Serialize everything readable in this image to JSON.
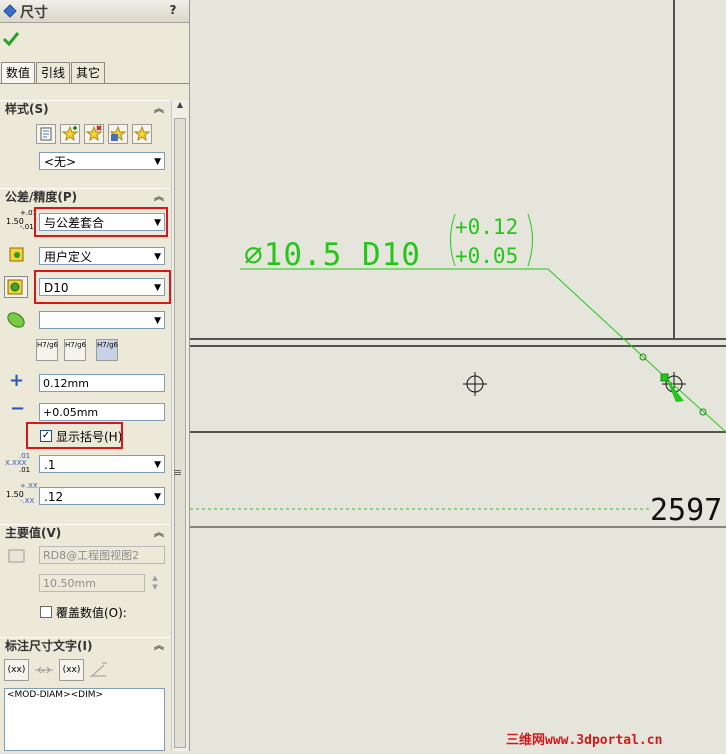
{
  "panel": {
    "title": "尺寸",
    "help": "?",
    "tabs": [
      {
        "label": "数值"
      },
      {
        "label": "引线"
      },
      {
        "label": "其它"
      }
    ],
    "style_section": {
      "title": "样式(S)",
      "select_value": "<无>"
    },
    "tolerance_section": {
      "title": "公差/精度(P)",
      "tolerance_type": "与公差套合",
      "classification": "用户定义",
      "hole_fit": "D10",
      "shaft_fit": "",
      "upper_value": "0.12mm",
      "lower_value": "+0.05mm",
      "show_parentheses_label": "显示括号(H)",
      "show_parentheses_checked": true,
      "primary_precision": ".1",
      "tolerance_precision": ".12",
      "fit_btn_labels": [
        "H7/g6",
        "H7/g6",
        "H7/g6"
      ],
      "prec_icon_text": "1.50",
      "prec_icon_sup": "+.01",
      "prec_icon_sub": "-.01",
      "xx_icon": "X.XXX",
      "xx_sub": ".01",
      "tol_icon_text": "1.50",
      "tol_icon_sup": "+.XX",
      "tol_icon_sub": "-.XX"
    },
    "primary_value_section": {
      "title": "主要值(V)",
      "reference": "RD8@工程图视图2",
      "value": "10.50mm",
      "override_label": "覆盖数值(O):"
    },
    "dimension_text_section": {
      "title": "标注尺寸文字(I)",
      "text": "<MOD-DIAM><DIM>",
      "btn_xx1": "(xx)",
      "btn_xx2": "(xx)"
    }
  },
  "drawing": {
    "dim_main": "∅10.5 D10",
    "tol_upper": "+0.12",
    "tol_lower": "+0.05",
    "side_number": "2597"
  },
  "watermark": "三维网www.3dportal.cn",
  "colors": {
    "dim_green": "#24c61a",
    "red_highlight": "#d81818",
    "panel_bg": "#ece9d8",
    "canvas_bg": "#e6e5dc"
  }
}
